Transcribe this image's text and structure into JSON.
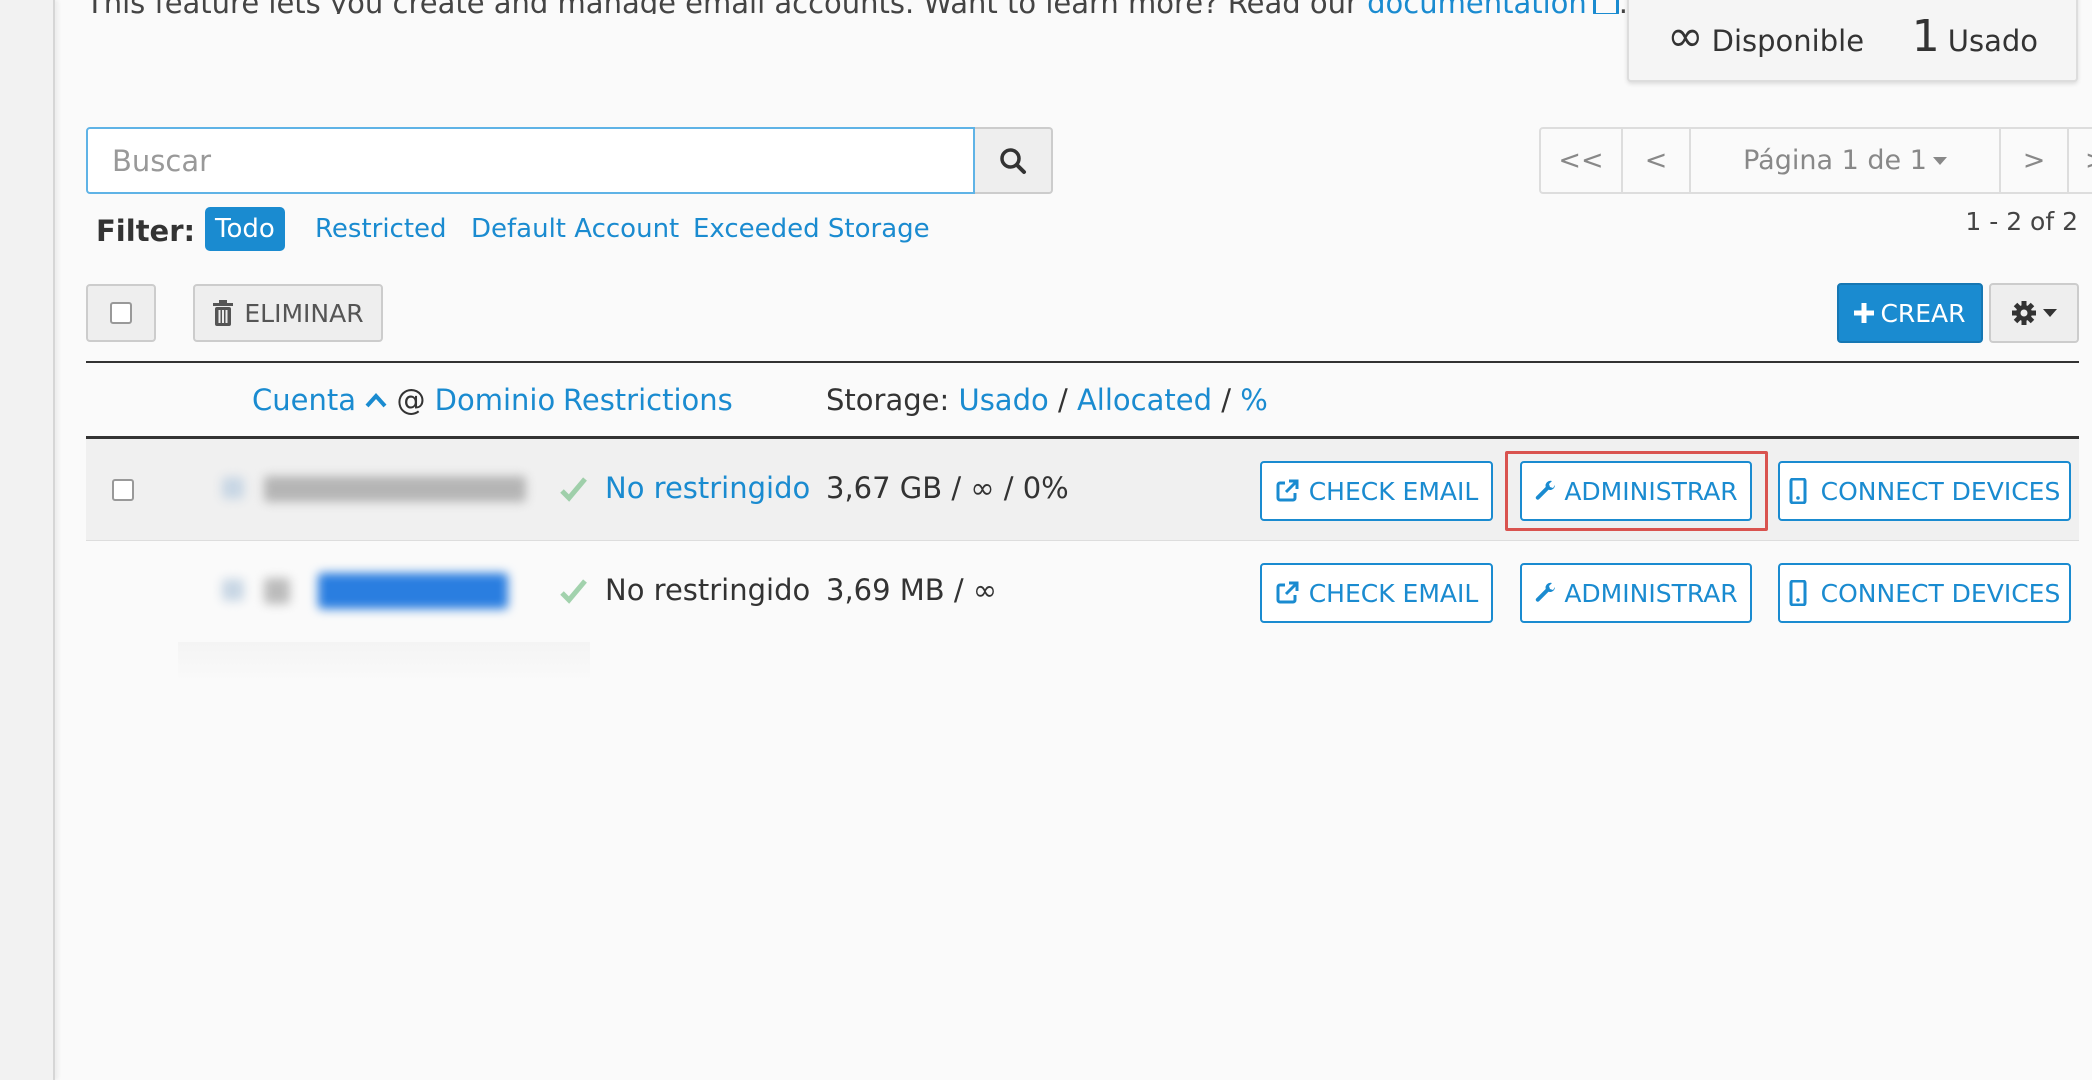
{
  "intro": {
    "text": "This feature lets you create and manage email accounts. Want to learn more? Read our ",
    "link": "documentation",
    "suffix": "."
  },
  "stats": {
    "available_value": "∞",
    "available_label": "Disponible",
    "used_value": "1",
    "used_label": "Usado"
  },
  "search": {
    "placeholder": "Buscar",
    "value": ""
  },
  "pagination": {
    "first": "<<",
    "prev": "<",
    "page_label": "Página 1 de 1",
    "next": ">",
    "last": ">>",
    "range": "1 - 2 of 2"
  },
  "filter": {
    "label": "Filter:",
    "options": [
      "Todo",
      "Restricted",
      "Default Account",
      "Exceeded Storage"
    ],
    "active": "Todo"
  },
  "toolbar": {
    "delete_label": "ELIMINAR",
    "create_label": "CREAR"
  },
  "table": {
    "headers": {
      "account": "Cuenta",
      "at": "@",
      "domain": "Dominio",
      "restrictions": "Restrictions",
      "storage_prefix": "Storage:",
      "used": "Usado",
      "sep1": "/",
      "allocated": "Allocated",
      "sep2": "/",
      "percent": "%"
    },
    "rows": [
      {
        "restriction": "No restringido",
        "storage": "3,67 GB / ∞ / 0%",
        "check_email": "CHECK EMAIL",
        "administrar": "ADMINISTRAR",
        "connect": "CONNECT DEVICES"
      },
      {
        "restriction": "No restringido",
        "storage": "3,69 MB / ∞",
        "check_email": "CHECK EMAIL",
        "administrar": "ADMINISTRAR",
        "connect": "CONNECT DEVICES"
      }
    ]
  },
  "colors": {
    "primary": "#1a8bd0",
    "highlight_box": "#d9534f",
    "text": "#333333"
  }
}
